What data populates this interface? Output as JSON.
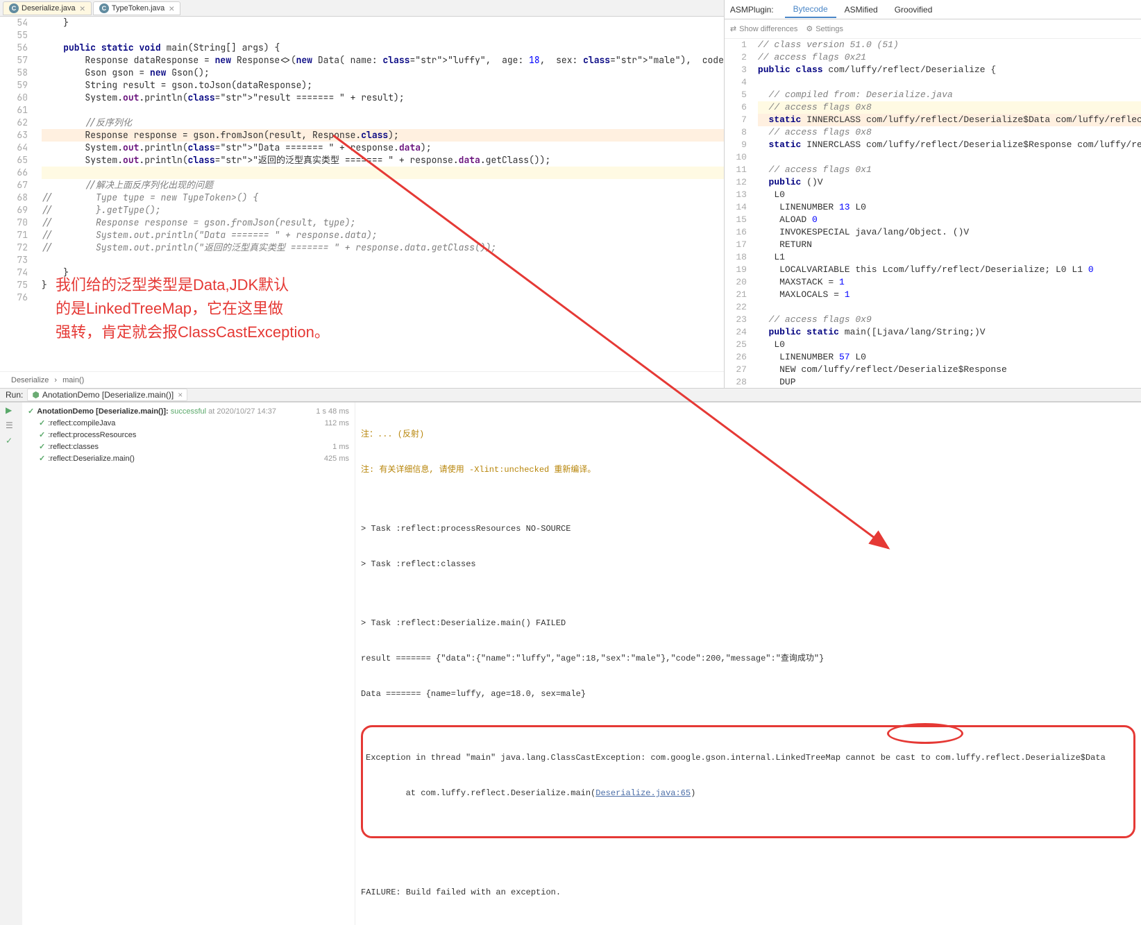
{
  "tabs": [
    {
      "label": "Deserialize.java",
      "active": true
    },
    {
      "label": "TypeToken.java",
      "active": false
    }
  ],
  "gutter_start": 54,
  "code_lines": [
    "    }",
    "",
    "    public static void main(String[] args) {",
    "        Response<Data> dataResponse = new Response<>(new Data( name: \"luffy\",  age: 18,  sex: \"male\"),  code",
    "        Gson gson = new Gson();",
    "        String result = gson.toJson(dataResponse);",
    "        System.out.println(\"result ======= \" + result);",
    "",
    "        //反序列化",
    "        Response<Data> response = gson.fromJson(result, Response.class);",
    "        System.out.println(\"Data ======= \" + response.data);",
    "        System.out.println(\"返回的泛型真实类型 ======= \" + response.data.getClass());",
    "",
    "        //解决上面反序列化出现的问题",
    "//        Type type = new TypeToken<Response<Data>>() {",
    "//        }.getType();",
    "//        Response<Data> response = gson.fromJson(result, type);",
    "//        System.out.println(\"Data ======= \" + response.data);",
    "//        System.out.println(\"返回的泛型真实类型 ======= \" + response.data.getClass());",
    "",
    "    }",
    "}",
    ""
  ],
  "breadcrumb": {
    "class": "Deserialize",
    "method": "main()"
  },
  "annotation": {
    "line1": "我们给的泛型类型是Data,JDK默认",
    "line2": "的是LinkedTreeMap，它在这里做",
    "line3": "强转，肯定就会报ClassCastException。"
  },
  "asm": {
    "label": "ASMPlugin:",
    "tabs": [
      "Bytecode",
      "ASMified",
      "Groovified"
    ],
    "active_tab": 0,
    "show_diff": "Show differences",
    "settings": "Settings"
  },
  "bytecode_lines": [
    "// class version 51.0 (51)",
    "// access flags 0x21",
    "public class com/luffy/reflect/Deserialize {",
    "",
    "  // compiled from: Deserialize.java",
    "  // access flags 0x8",
    "  static INNERCLASS com/luffy/reflect/Deserialize$Data com/luffy/reflect/Deserialize Data",
    "  // access flags 0x8",
    "  static INNERCLASS com/luffy/reflect/Deserialize$Response com/luffy/reflect/Deserialize Response",
    "",
    "  // access flags 0x1",
    "  public <init>()V",
    "   L0",
    "    LINENUMBER 13 L0",
    "    ALOAD 0",
    "    INVOKESPECIAL java/lang/Object.<init> ()V",
    "    RETURN",
    "   L1",
    "    LOCALVARIABLE this Lcom/luffy/reflect/Deserialize; L0 L1 0",
    "    MAXSTACK = 1",
    "    MAXLOCALS = 1",
    "",
    "  // access flags 0x9",
    "  public static main([Ljava/lang/String;)V",
    "   L0",
    "    LINENUMBER 57 L0",
    "    NEW com/luffy/reflect/Deserialize$Response",
    "    DUP"
  ],
  "run": {
    "label": "Run:",
    "tab": "AnotationDemo [Deserialize.main()]",
    "header": "AnotationDemo [Deserialize.main()]:",
    "status": "successful",
    "at": "at 2020/10/27 14:37",
    "tree": [
      {
        "label": ":reflect:compileJava",
        "time": "112 ms"
      },
      {
        "label": ":reflect:processResources",
        "time": ""
      },
      {
        "label": ":reflect:classes",
        "time": "1 ms"
      },
      {
        "label": ":reflect:Deserialize.main()",
        "time": "425 ms"
      }
    ],
    "total_time": "1 s 48 ms",
    "output_warn": "注: 有关详细信息, 请使用 -Xlint:unchecked 重新编译。",
    "task1": "> Task :reflect:processResources NO-SOURCE",
    "task2": "> Task :reflect:classes",
    "task3": "> Task :reflect:Deserialize.main() FAILED",
    "result_line": "result ======= {\"data\":{\"name\":\"luffy\",\"age\":18,\"sex\":\"male\"},\"code\":200,\"message\":\"查询成功\"}",
    "data_line": "Data ======= {name=luffy, age=18.0, sex=male}",
    "exception": "Exception in thread \"main\" java.lang.ClassCastException: com.google.gson.internal.LinkedTreeMap cannot be cast to com.luffy.reflect.Deserialize$Data",
    "exception_at": "        at com.luffy.reflect.Deserialize.main(",
    "exception_link": "Deserialize.java:65",
    "failure": "FAILURE: Build failed with an exception."
  }
}
